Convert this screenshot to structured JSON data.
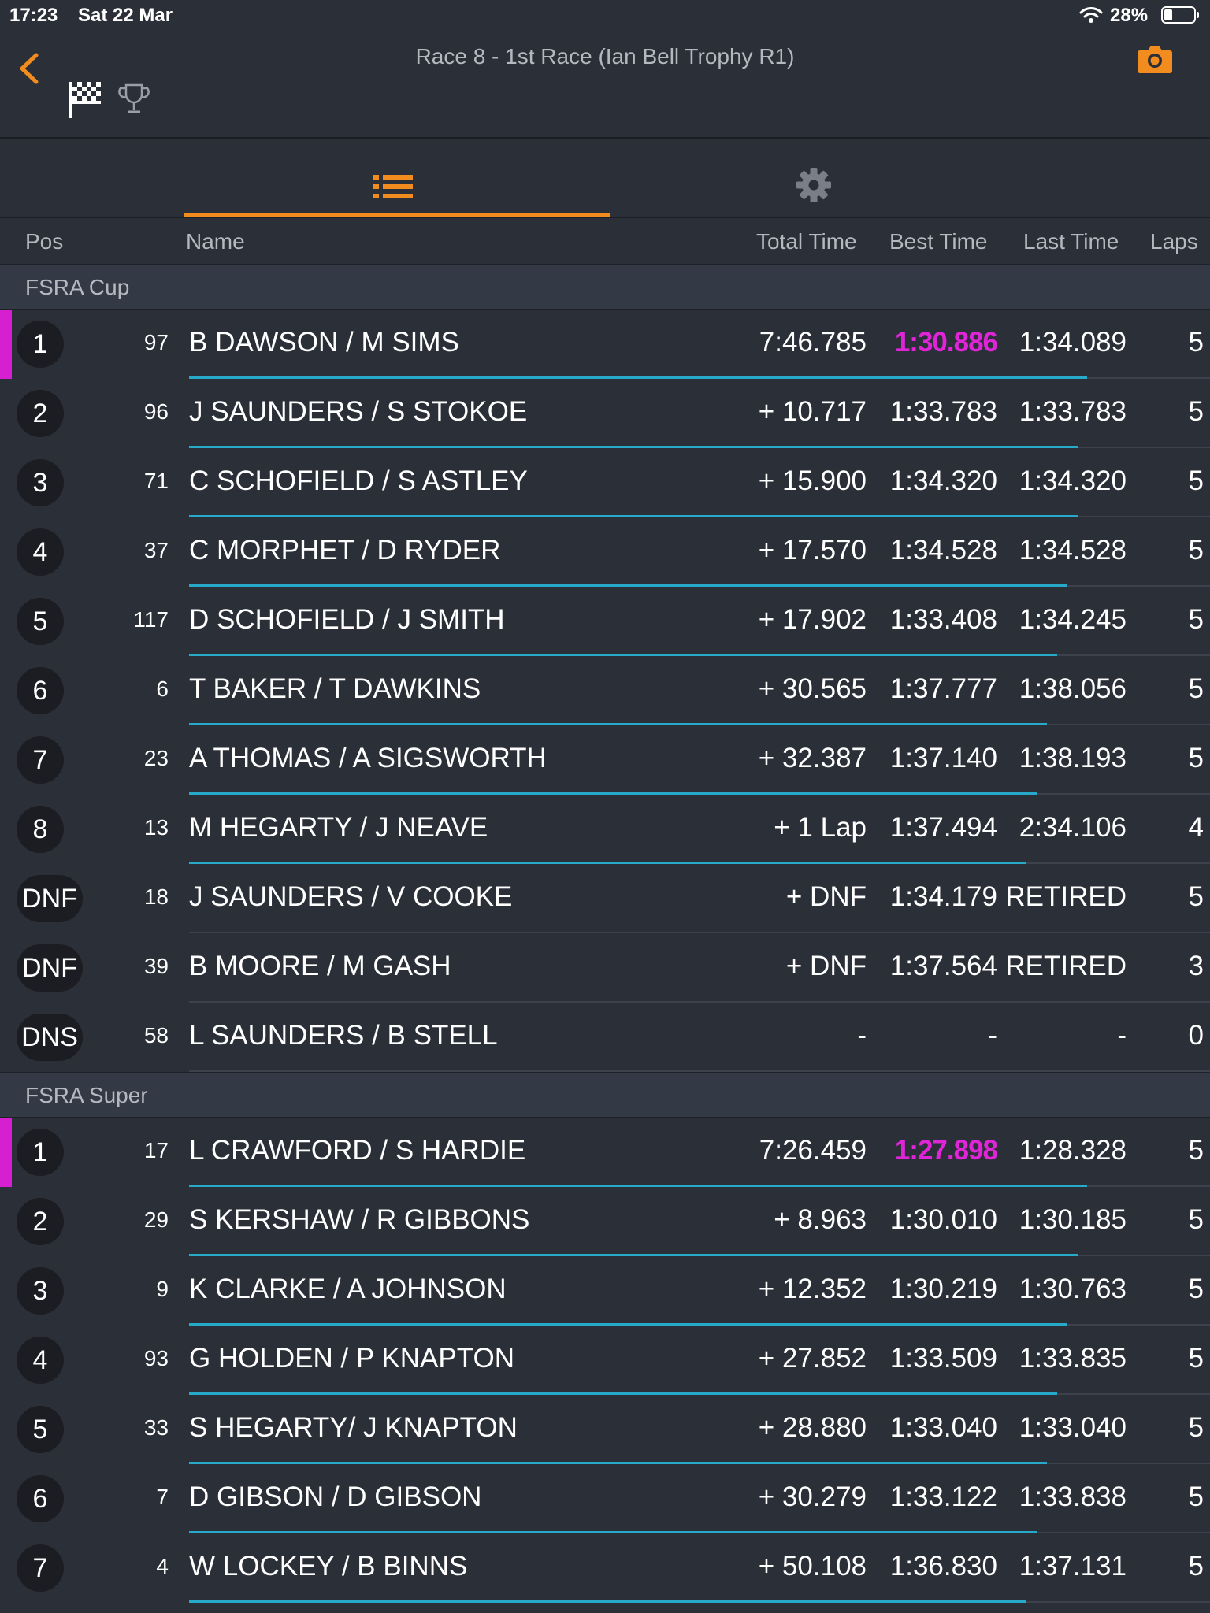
{
  "status_bar": {
    "time": "17:23",
    "date": "Sat 22 Mar",
    "battery": "28%",
    "battery_level": 0.28
  },
  "header": {
    "title": "Race 8 - 1st Race (Ian Bell Trophy R1)",
    "accent": "#f28c1e"
  },
  "tabs": [
    {
      "icon": "list-icon",
      "active": true
    },
    {
      "icon": "gear-icon",
      "active": false
    }
  ],
  "columns": {
    "pos": "Pos",
    "name": "Name",
    "total": "Total Time",
    "best": "Best Time",
    "last": "Last Time",
    "laps": "Laps"
  },
  "colors": {
    "fastest": "#e024d8",
    "progress": "#27a9c9",
    "background": "#2b2f38"
  },
  "sections": [
    {
      "title": "FSRA Cup",
      "rows": [
        {
          "pos": "1",
          "num": "97",
          "name": "B DAWSON / M SIMS",
          "total": "7:46.785",
          "best": "1:30.886",
          "last": "1:34.089",
          "laps": "5",
          "fastest": true,
          "progress": 0.88
        },
        {
          "pos": "2",
          "num": "96",
          "name": "J SAUNDERS / S STOKOE",
          "total": "+ 10.717",
          "best": "1:33.783",
          "last": "1:33.783",
          "laps": "5",
          "fastest": false,
          "progress": 0.87
        },
        {
          "pos": "3",
          "num": "71",
          "name": "C SCHOFIELD / S ASTLEY",
          "total": "+ 15.900",
          "best": "1:34.320",
          "last": "1:34.320",
          "laps": "5",
          "fastest": false,
          "progress": 0.87
        },
        {
          "pos": "4",
          "num": "37",
          "name": "C MORPHET / D RYDER",
          "total": "+ 17.570",
          "best": "1:34.528",
          "last": "1:34.528",
          "laps": "5",
          "fastest": false,
          "progress": 0.86
        },
        {
          "pos": "5",
          "num": "117",
          "name": "D SCHOFIELD / J SMITH",
          "total": "+ 17.902",
          "best": "1:33.408",
          "last": "1:34.245",
          "laps": "5",
          "fastest": false,
          "progress": 0.85
        },
        {
          "pos": "6",
          "num": "6",
          "name": "T BAKER / T DAWKINS",
          "total": "+ 30.565",
          "best": "1:37.777",
          "last": "1:38.056",
          "laps": "5",
          "fastest": false,
          "progress": 0.84
        },
        {
          "pos": "7",
          "num": "23",
          "name": "A THOMAS / A SIGSWORTH",
          "total": "+ 32.387",
          "best": "1:37.140",
          "last": "1:38.193",
          "laps": "5",
          "fastest": false,
          "progress": 0.83
        },
        {
          "pos": "8",
          "num": "13",
          "name": "M HEGARTY / J NEAVE",
          "total": "+ 1 Lap",
          "best": "1:37.494",
          "last": "2:34.106",
          "laps": "4",
          "fastest": false,
          "progress": 0.82
        },
        {
          "pos": "DNF",
          "num": "18",
          "name": "J SAUNDERS / V COOKE",
          "total": "+ DNF",
          "best": "1:34.179",
          "last": "RETIRED",
          "laps": "5",
          "fastest": false,
          "progress": 0
        },
        {
          "pos": "DNF",
          "num": "39",
          "name": "B MOORE / M GASH",
          "total": "+ DNF",
          "best": "1:37.564",
          "last": "RETIRED",
          "laps": "3",
          "fastest": false,
          "progress": 0
        },
        {
          "pos": "DNS",
          "num": "58",
          "name": "L SAUNDERS / B STELL",
          "total": "-",
          "best": "-",
          "last": "-",
          "laps": "0",
          "fastest": false,
          "progress": 0
        }
      ]
    },
    {
      "title": "FSRA Super",
      "rows": [
        {
          "pos": "1",
          "num": "17",
          "name": "L CRAWFORD / S HARDIE",
          "total": "7:26.459",
          "best": "1:27.898",
          "last": "1:28.328",
          "laps": "5",
          "fastest": true,
          "progress": 0.88
        },
        {
          "pos": "2",
          "num": "29",
          "name": "S KERSHAW / R GIBBONS",
          "total": "+ 8.963",
          "best": "1:30.010",
          "last": "1:30.185",
          "laps": "5",
          "fastest": false,
          "progress": 0.87
        },
        {
          "pos": "3",
          "num": "9",
          "name": "K CLARKE / A JOHNSON",
          "total": "+ 12.352",
          "best": "1:30.219",
          "last": "1:30.763",
          "laps": "5",
          "fastest": false,
          "progress": 0.86
        },
        {
          "pos": "4",
          "num": "93",
          "name": "G HOLDEN / P KNAPTON",
          "total": "+ 27.852",
          "best": "1:33.509",
          "last": "1:33.835",
          "laps": "5",
          "fastest": false,
          "progress": 0.85
        },
        {
          "pos": "5",
          "num": "33",
          "name": "S HEGARTY/ J KNAPTON",
          "total": "+ 28.880",
          "best": "1:33.040",
          "last": "1:33.040",
          "laps": "5",
          "fastest": false,
          "progress": 0.84
        },
        {
          "pos": "6",
          "num": "7",
          "name": "D GIBSON / D GIBSON",
          "total": "+ 30.279",
          "best": "1:33.122",
          "last": "1:33.838",
          "laps": "5",
          "fastest": false,
          "progress": 0.83
        },
        {
          "pos": "7",
          "num": "4",
          "name": "W LOCKEY / B BINNS",
          "total": "+ 50.108",
          "best": "1:36.830",
          "last": "1:37.131",
          "laps": "5",
          "fastest": false,
          "progress": 0.82
        }
      ]
    }
  ]
}
